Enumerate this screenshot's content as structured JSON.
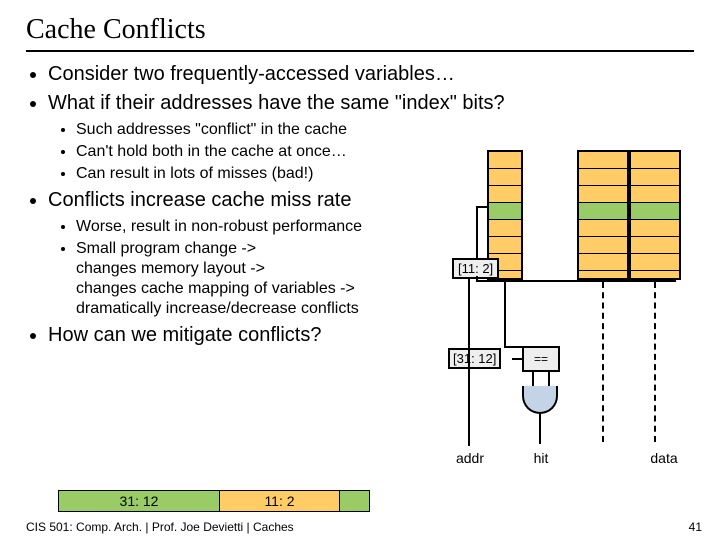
{
  "title": "Cache Conflicts",
  "bullets": {
    "b1": "Consider two frequently-accessed variables…",
    "b2": "What if their addresses have the same \"index\" bits?",
    "b2s1": "Such addresses \"conflict\" in the cache",
    "b2s2": "Can't hold both in the cache at once…",
    "b2s3": "Can result in lots of misses (bad!)",
    "b3": "Conflicts increase cache miss rate",
    "b3s1": "Worse, result in non-robust performance",
    "b3s2": "Small program change ->\nchanges memory layout ->\nchanges cache mapping of variables ->\ndramatically increase/decrease conflicts",
    "b4": "How can we mitigate conflicts?"
  },
  "addr": {
    "tag": "31: 12",
    "index": "11: 2"
  },
  "diagram": {
    "index_bits": "[11: 2]",
    "tag_bits": "[31: 12]",
    "addr_label": "addr",
    "hit_label": "hit",
    "data_label": "data",
    "cmp": "=="
  },
  "footer": {
    "left": "CIS 501: Comp. Arch.  |  Prof. Joe Devietti  |  Caches",
    "page": "41"
  }
}
